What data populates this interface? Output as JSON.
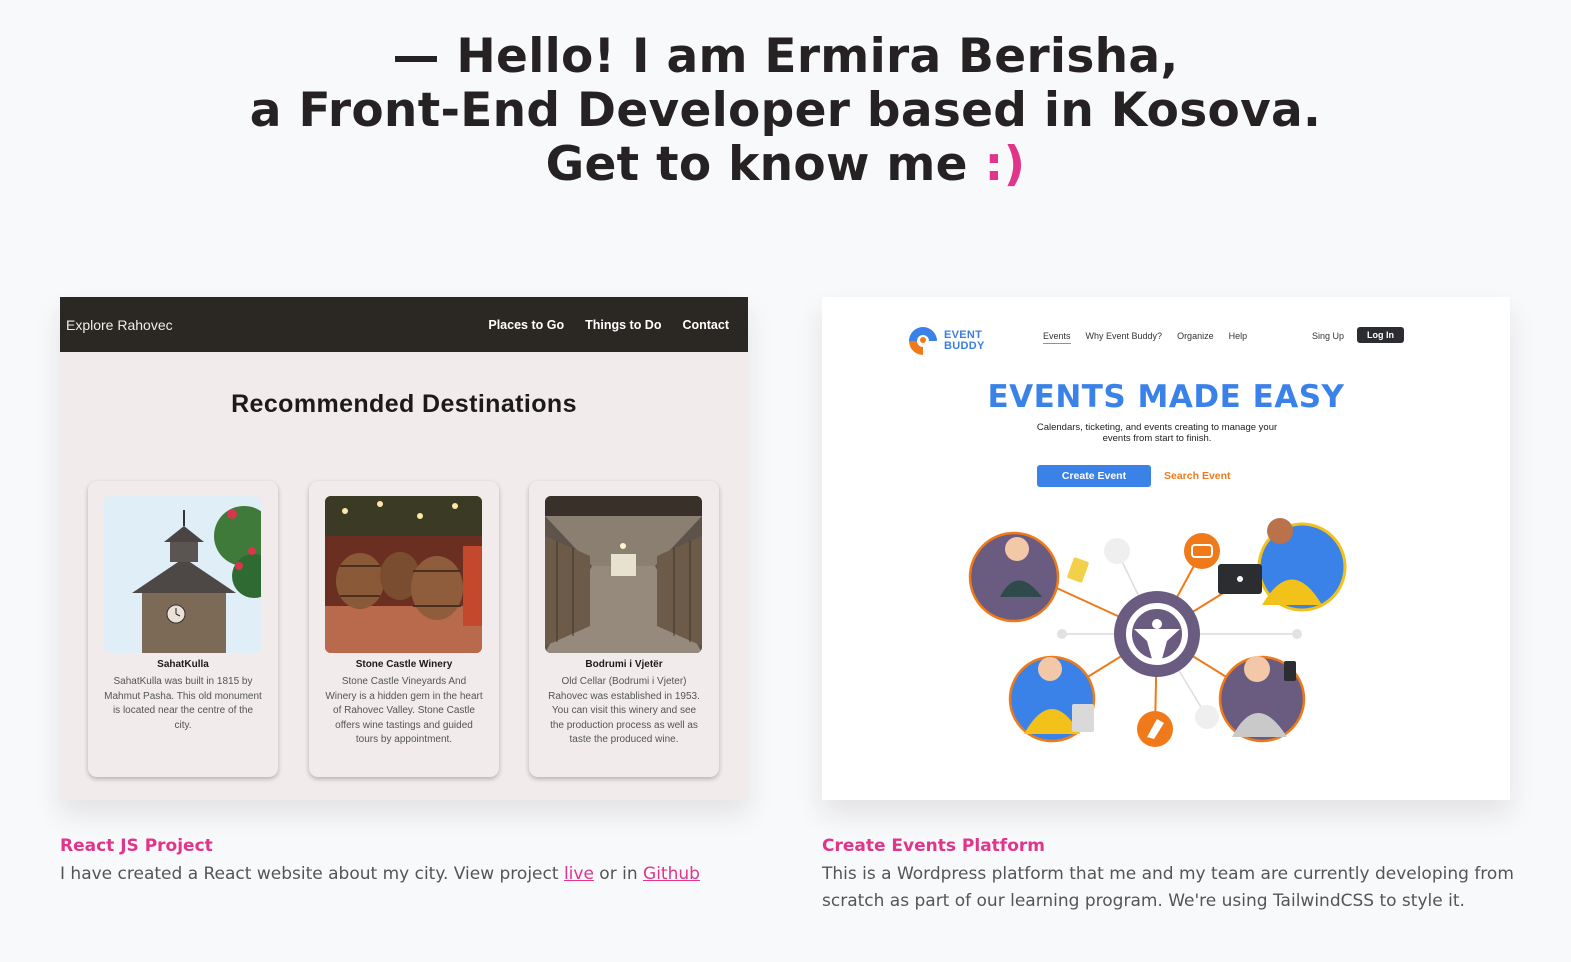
{
  "hero": {
    "line1": "— Hello! I am Ermira Berisha,",
    "line2": "a Front-End Developer based in Kosova.",
    "line3": "Get to know me ",
    "smile": ":)",
    "accent_color": "#e0358a"
  },
  "projects": [
    {
      "screenshot": {
        "brand": "Explore Rahovec",
        "nav": [
          "Places to Go",
          "Things to Do",
          "Contact"
        ],
        "heading": "Recommended Destinations",
        "cards": [
          {
            "title": "SahatKulla",
            "text": "SahatKulla was built in 1815 by Mahmut Pasha. This old monument is located near the centre of the city."
          },
          {
            "title": "Stone Castle Winery",
            "text": "Stone Castle Vineyards And Winery is a hidden gem in the heart of Rahovec Valley. Stone Castle offers wine tastings and guided tours by appointment."
          },
          {
            "title": "Bodrumi i Vjetër",
            "text": "Old Cellar (Bodrumi i Vjeter) Rahovec was established in 1953. You can visit this winery and see the production process as well as taste the produced wine."
          }
        ]
      },
      "title": "React JS Project",
      "text_before": "I have created a React website about my city. View project ",
      "link1": "live",
      "text_middle": " or in ",
      "link2": "Github"
    },
    {
      "screenshot": {
        "logo_line1": "EVENT",
        "logo_line2": "BUDDY",
        "nav": [
          "Events",
          "Why Event Buddy?",
          "Organize",
          "Help"
        ],
        "signup": "Sing Up",
        "login": "Log In",
        "headline": "EVENTS MADE EASY",
        "subtitle": "Calendars, ticketing, and events creating to manage your events from start to finish.",
        "primary_button": "Create Event",
        "secondary_button": "Search Event"
      },
      "title": "Create Events Platform",
      "text": "This is a Wordpress platform that me and my team are currently developing from scratch as part of our learning program. We're using TailwindCSS to style it."
    }
  ]
}
